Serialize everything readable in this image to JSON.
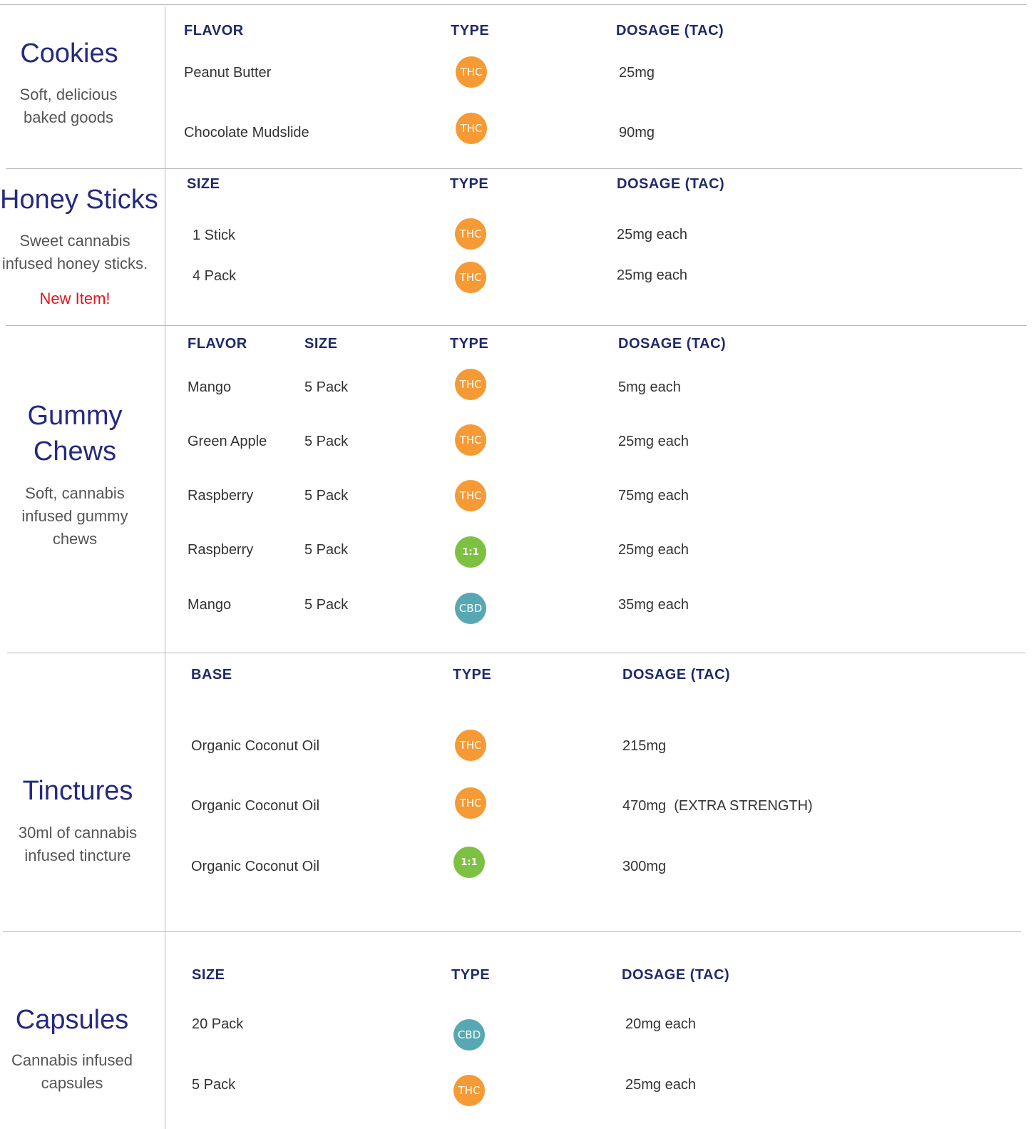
{
  "colors": {
    "title": "#252a80",
    "header": "#1f2a6b",
    "new_item": "#e2141b",
    "thc": "#f59a34",
    "one_to_one": "#7dc142",
    "cbd": "#58a8b4"
  },
  "cookies": {
    "title": "Cookies",
    "desc": "Soft, delicious baked goods",
    "headers": {
      "flavor": "FLAVOR",
      "type": "TYPE",
      "dosage": "DOSAGE (TAC)"
    },
    "rows": [
      {
        "flavor": "Peanut Butter",
        "type": "THC",
        "dosage": "25mg"
      },
      {
        "flavor": "Chocolate Mudslide",
        "type": "THC",
        "dosage": "90mg"
      }
    ]
  },
  "honey": {
    "title": "Honey Sticks",
    "desc": "Sweet cannabis infused honey sticks.",
    "note": "New Item!",
    "headers": {
      "size": "SIZE",
      "type": "TYPE",
      "dosage": "DOSAGE (TAC)"
    },
    "rows": [
      {
        "size": "1 Stick",
        "type": "THC",
        "dosage": "25mg each"
      },
      {
        "size": "4 Pack",
        "type": "THC",
        "dosage": "25mg each"
      }
    ]
  },
  "gummy": {
    "title": "Gummy Chews",
    "desc": "Soft, cannabis infused gummy chews",
    "headers": {
      "flavor": "FLAVOR",
      "size": "SIZE",
      "type": "TYPE",
      "dosage": "DOSAGE (TAC)"
    },
    "rows": [
      {
        "flavor": "Mango",
        "size": "5 Pack",
        "type": "THC",
        "dosage": "5mg each"
      },
      {
        "flavor": "Green Apple",
        "size": "5 Pack",
        "type": "THC",
        "dosage": "25mg each"
      },
      {
        "flavor": "Raspberry",
        "size": "5 Pack",
        "type": "THC",
        "dosage": "75mg each"
      },
      {
        "flavor": "Raspberry",
        "size": "5 Pack",
        "type": "1:1",
        "dosage": "25mg each"
      },
      {
        "flavor": "Mango",
        "size": "5 Pack",
        "type": "CBD",
        "dosage": "35mg each"
      }
    ]
  },
  "tinctures": {
    "title": "Tinctures",
    "desc": "30ml of cannabis infused tincture",
    "headers": {
      "base": "BASE",
      "type": "TYPE",
      "dosage": "DOSAGE (TAC)"
    },
    "rows": [
      {
        "base": "Organic Coconut Oil",
        "type": "THC",
        "dosage": "215mg"
      },
      {
        "base": "Organic Coconut Oil",
        "type": "THC",
        "dosage": "470mg  (EXTRA STRENGTH)"
      },
      {
        "base": "Organic Coconut Oil",
        "type": "1:1",
        "dosage": "300mg"
      }
    ]
  },
  "capsules": {
    "title": "Capsules",
    "desc": "Cannabis infused capsules",
    "headers": {
      "size": "SIZE",
      "type": "TYPE",
      "dosage": "DOSAGE (TAC)"
    },
    "rows": [
      {
        "size": "20 Pack",
        "type": "CBD",
        "dosage": "20mg each"
      },
      {
        "size": "5 Pack",
        "type": "THC",
        "dosage": "25mg each"
      }
    ]
  }
}
